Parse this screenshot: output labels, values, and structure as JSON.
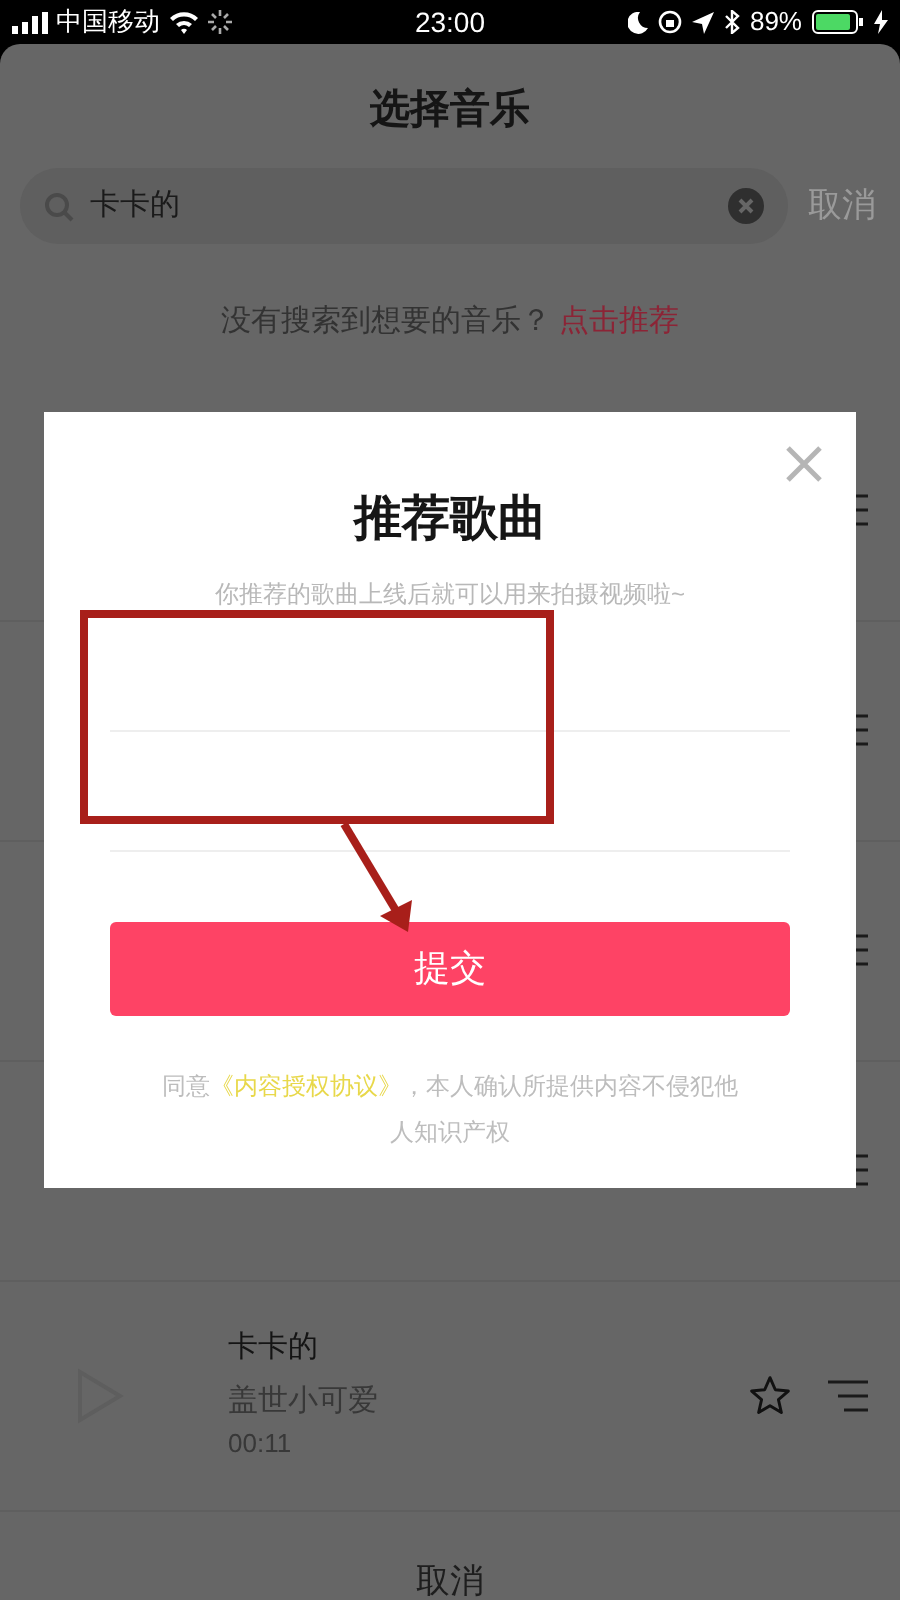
{
  "status_bar": {
    "carrier": "中国移动",
    "time": "23:00",
    "battery": "89%"
  },
  "sheet": {
    "title": "选择音乐",
    "search": {
      "value": "卡卡的",
      "cancel": "取消"
    },
    "hint": {
      "text": "没有搜索到想要的音乐？",
      "link": "点击推荐"
    },
    "songs": [
      {
        "title": "卡卡的",
        "artist": "盖世小可爱",
        "duration": "00:11"
      }
    ],
    "cancel": "取消"
  },
  "dialog": {
    "title": "推荐歌曲",
    "subtitle": "你推荐的歌曲上线后就可以用来拍摄视频啦~",
    "submit": "提交",
    "terms": {
      "prefix": "同意",
      "link": "《内容授权协议》",
      "suffix": "，本人确认所提供内容不侵犯他人知识产权"
    }
  }
}
